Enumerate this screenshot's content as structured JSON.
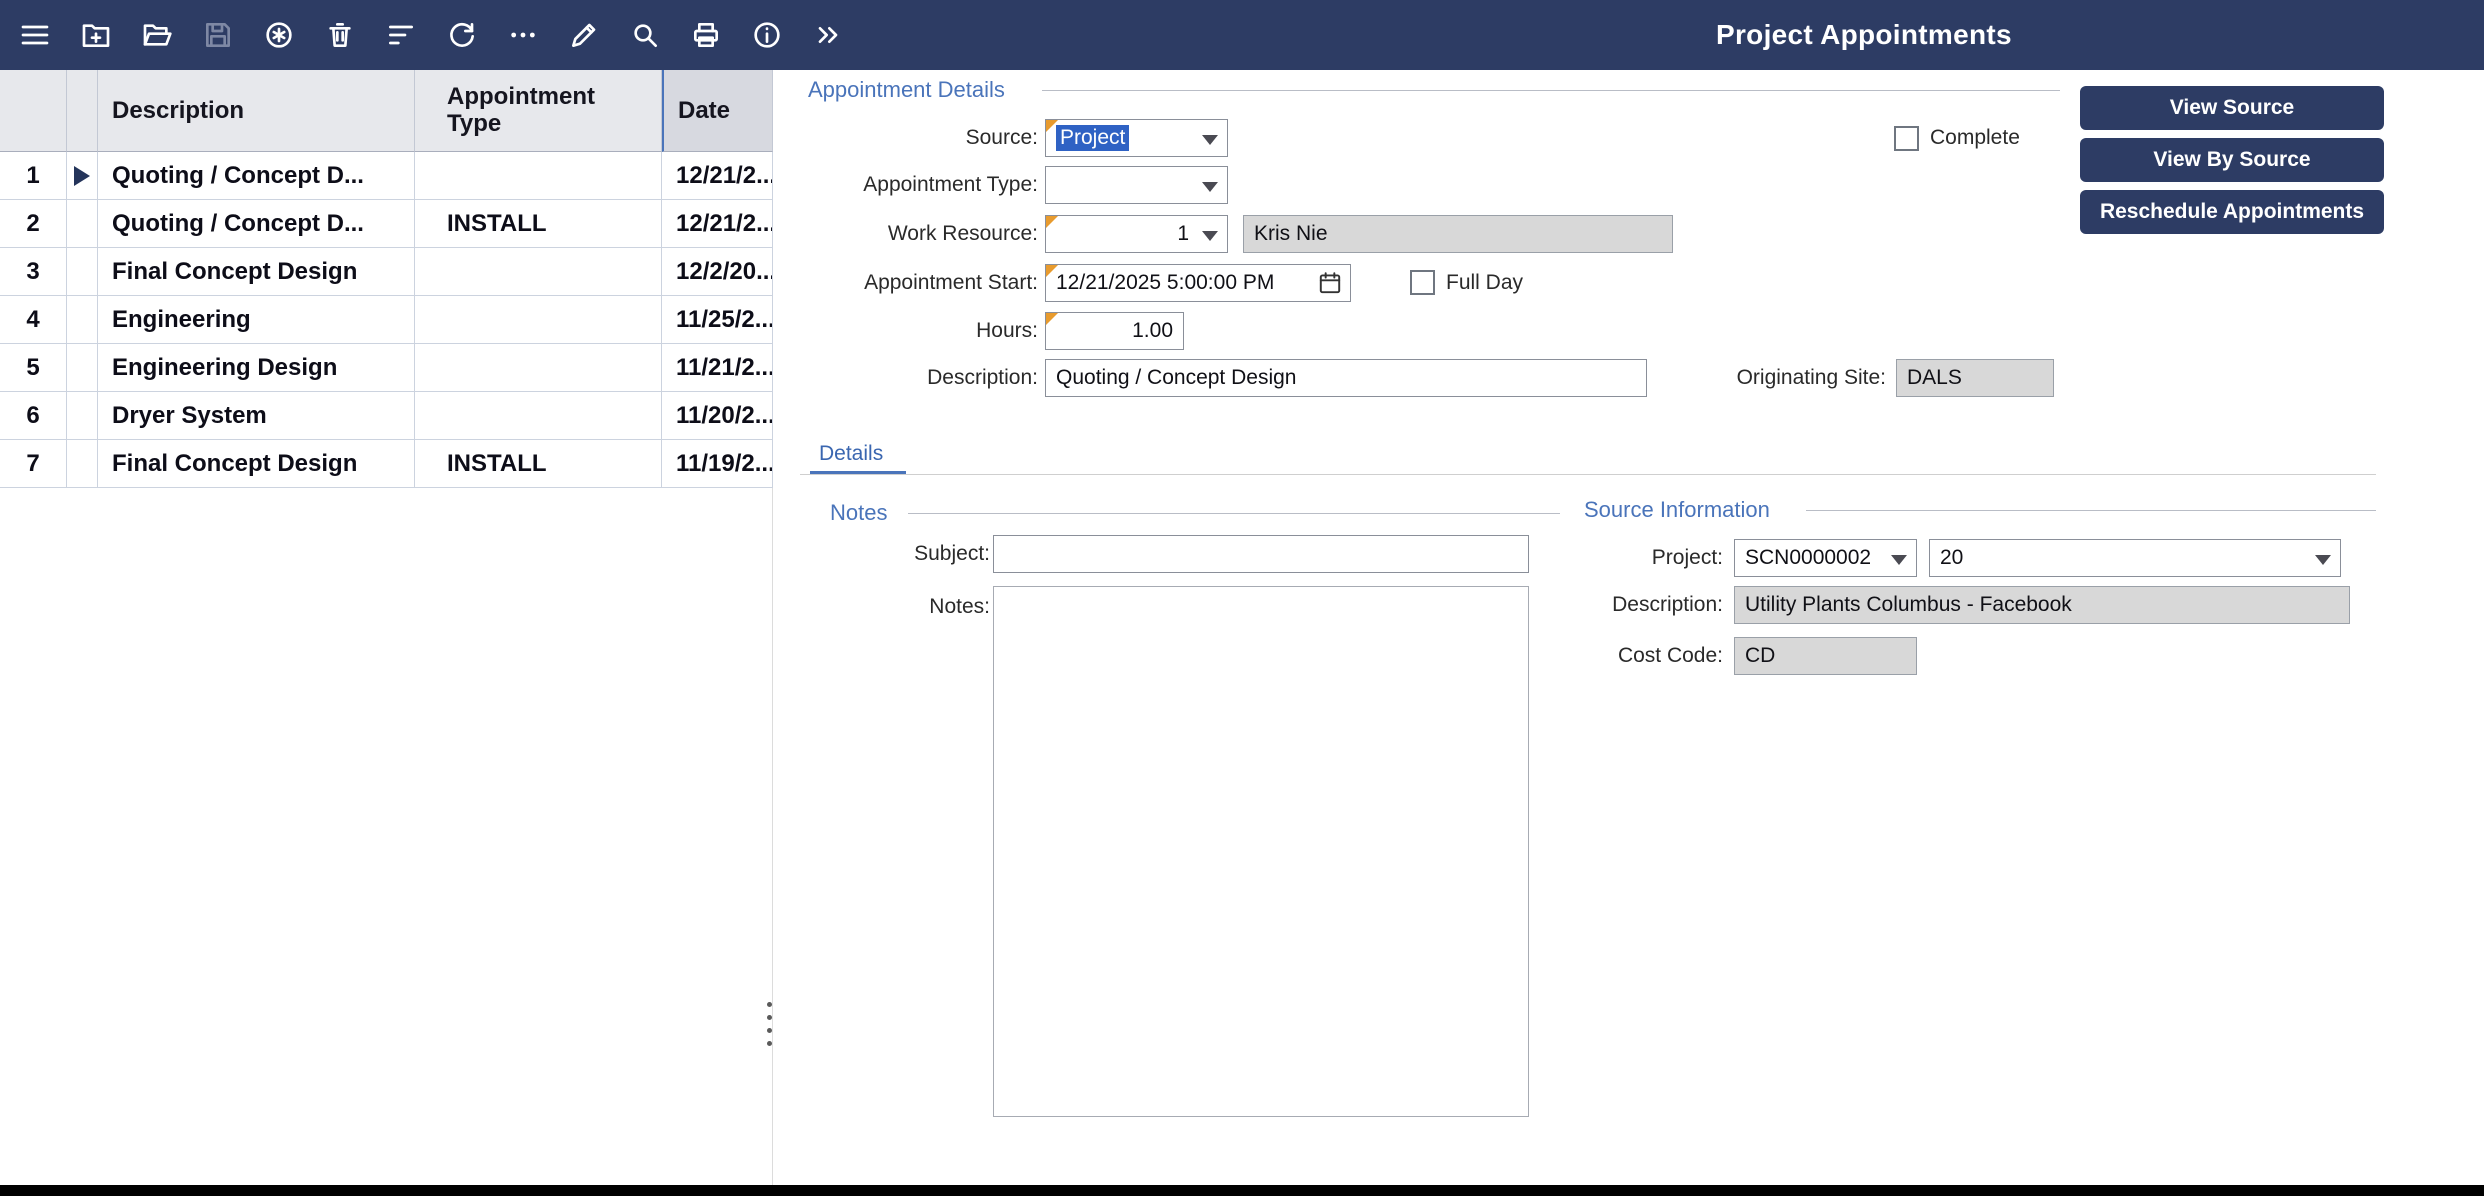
{
  "window": {
    "title": "Project Appointments"
  },
  "toolbar": {
    "icons": [
      "menu",
      "new-folder",
      "open-folder",
      "save",
      "cancel-record",
      "delete",
      "filter",
      "refresh",
      "more",
      "edit",
      "find",
      "print",
      "info",
      "expand"
    ]
  },
  "grid": {
    "headers": {
      "description": "Description",
      "type": "Appointment Type",
      "date": "Date"
    },
    "rows": [
      {
        "num": "1",
        "description": "Quoting / Concept D...",
        "type": "",
        "date": "12/21/2..."
      },
      {
        "num": "2",
        "description": "Quoting / Concept D...",
        "type": "INSTALL",
        "date": "12/21/2..."
      },
      {
        "num": "3",
        "description": "Final Concept Design",
        "type": "",
        "date": "12/2/20..."
      },
      {
        "num": "4",
        "description": "Engineering",
        "type": "",
        "date": "11/25/2..."
      },
      {
        "num": "5",
        "description": "Engineering Design",
        "type": "",
        "date": "11/21/2..."
      },
      {
        "num": "6",
        "description": "Dryer System",
        "type": "",
        "date": "11/20/2..."
      },
      {
        "num": "7",
        "description": "Final Concept Design",
        "type": "INSTALL",
        "date": "11/19/2..."
      }
    ]
  },
  "details": {
    "legend": "Appointment Details",
    "source_label": "Source:",
    "source_value": "Project",
    "type_label": "Appointment Type:",
    "type_value": "",
    "work_resource_label": "Work Resource:",
    "work_resource_value": "1",
    "work_resource_name": "Kris Nie",
    "start_label": "Appointment Start:",
    "start_value": "12/21/2025 5:00:00 PM",
    "full_day_label": "Full Day",
    "hours_label": "Hours:",
    "hours_value": "1.00",
    "description_label": "Description:",
    "description_value": "Quoting / Concept Design",
    "originating_site_label": "Originating Site:",
    "originating_site_value": "DALS",
    "complete_label": "Complete"
  },
  "actions": {
    "view_source": "View Source",
    "view_by_source": "View By Source",
    "reschedule": "Reschedule Appointments"
  },
  "tabs": {
    "details": "Details"
  },
  "notes": {
    "legend": "Notes",
    "subject_label": "Subject:",
    "subject_value": "",
    "notes_label": "Notes:",
    "notes_value": ""
  },
  "source_info": {
    "legend": "Source Information",
    "project_label": "Project:",
    "project_value": "SCN0000002",
    "project_line": "20",
    "description_label": "Description:",
    "description_value": "Utility Plants Columbus - Facebook",
    "cost_code_label": "Cost Code:",
    "cost_code_value": "CD"
  },
  "colors": {
    "toolbar_bg": "#2d3c64",
    "accent_blue": "#4a74ba",
    "selection_blue": "#2f62c4",
    "modified_orange": "#e89b2e",
    "readonly_bg": "#d8d8d8"
  }
}
